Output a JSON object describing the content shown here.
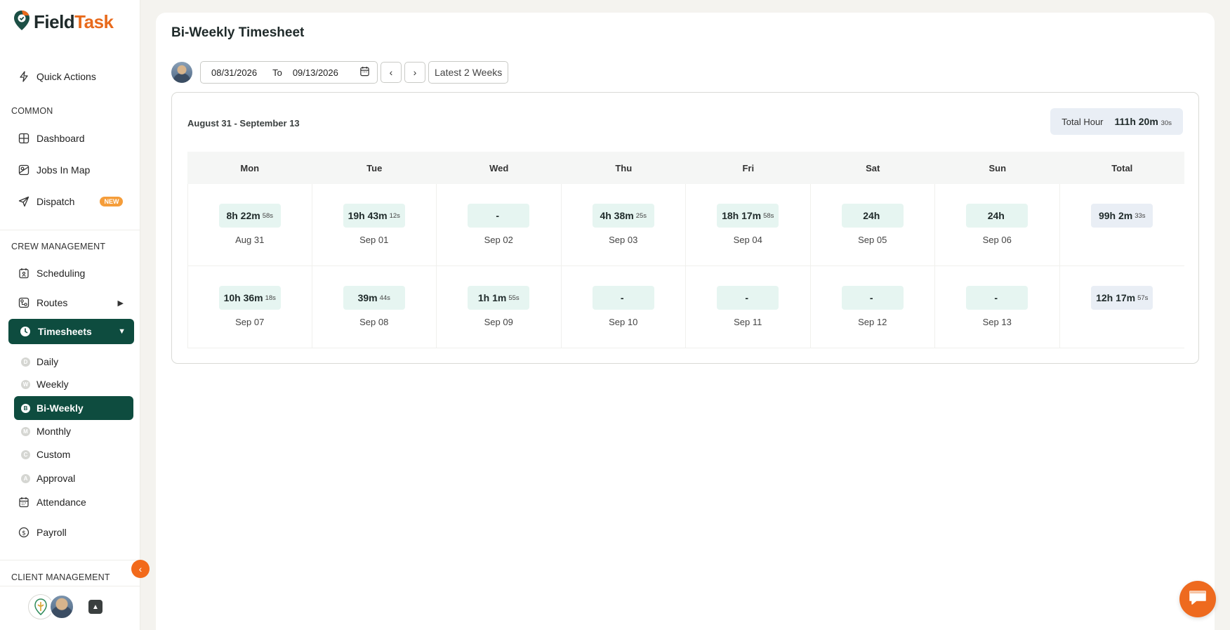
{
  "app": {
    "logo_part1": "Field",
    "logo_part2": "Task"
  },
  "sidebar": {
    "quick_actions": "Quick Actions",
    "sections": {
      "common": "COMMON",
      "crew": "CREW MANAGEMENT",
      "client": "CLIENT MANAGEMENT"
    },
    "common_items": {
      "dashboard": "Dashboard",
      "jobs_in_map": "Jobs In Map",
      "dispatch": "Dispatch",
      "dispatch_badge": "NEW"
    },
    "crew_items": {
      "scheduling": "Scheduling",
      "routes": "Routes",
      "timesheets": "Timesheets"
    },
    "timesheet_sub": [
      {
        "letter": "D",
        "label": "Daily"
      },
      {
        "letter": "W",
        "label": "Weekly"
      },
      {
        "letter": "B",
        "label": "Bi-Weekly"
      },
      {
        "letter": "M",
        "label": "Monthly"
      },
      {
        "letter": "C",
        "label": "Custom"
      },
      {
        "letter": "A",
        "label": "Approval"
      }
    ],
    "attendance": "Attendance",
    "payroll": "Payroll",
    "collapse_glyph": "‹",
    "footer_up_glyph": "▲"
  },
  "page": {
    "title": "Bi-Weekly Timesheet",
    "toolbar": {
      "from": "08/31/2026",
      "to_label": "To",
      "to": "09/13/2026",
      "prev": "‹",
      "next": "›",
      "latest": "Latest 2 Weeks"
    },
    "range_label": "August 31 - September 13",
    "total_hour": {
      "label": "Total Hour",
      "value": "111h 20m",
      "secs": "30s"
    },
    "days": [
      "Mon",
      "Tue",
      "Wed",
      "Thu",
      "Fri",
      "Sat",
      "Sun",
      "Total"
    ],
    "weeks": [
      [
        {
          "main": "8h 22m",
          "secs": "58s",
          "date": "Aug 31"
        },
        {
          "main": "19h 43m",
          "secs": "12s",
          "date": "Sep 01"
        },
        {
          "main": "-",
          "secs": "",
          "date": "Sep 02"
        },
        {
          "main": "4h 38m",
          "secs": "25s",
          "date": "Sep 03"
        },
        {
          "main": "18h 17m",
          "secs": "58s",
          "date": "Sep 04"
        },
        {
          "main": "24h",
          "secs": "",
          "date": "Sep 05"
        },
        {
          "main": "24h",
          "secs": "",
          "date": "Sep 06"
        },
        {
          "main": "99h 2m",
          "secs": "33s",
          "date": ""
        }
      ],
      [
        {
          "main": "10h 36m",
          "secs": "18s",
          "date": "Sep 07"
        },
        {
          "main": "39m",
          "secs": "44s",
          "date": "Sep 08"
        },
        {
          "main": "1h 1m",
          "secs": "55s",
          "date": "Sep 09"
        },
        {
          "main": "-",
          "secs": "",
          "date": "Sep 10"
        },
        {
          "main": "-",
          "secs": "",
          "date": "Sep 11"
        },
        {
          "main": "-",
          "secs": "",
          "date": "Sep 12"
        },
        {
          "main": "-",
          "secs": "",
          "date": "Sep 13"
        },
        {
          "main": "12h 17m",
          "secs": "57s",
          "date": ""
        }
      ]
    ]
  },
  "colors": {
    "brand_green": "#0e4c3f",
    "brand_orange": "#e86a1c",
    "pill_green": "#e6f5f1",
    "pill_blue": "#e9eef5"
  },
  "icons": {
    "logo": "map-pin-check-icon",
    "quick_actions": "lightning-icon",
    "dashboard": "grid-icon",
    "jobs_in_map": "map-icon",
    "dispatch": "send-icon",
    "scheduling": "calendar-user-icon",
    "routes": "route-icon",
    "timesheets": "clock-icon",
    "attendance": "calendar-icon",
    "payroll": "dollar-icon",
    "chat": "chat-icon"
  }
}
